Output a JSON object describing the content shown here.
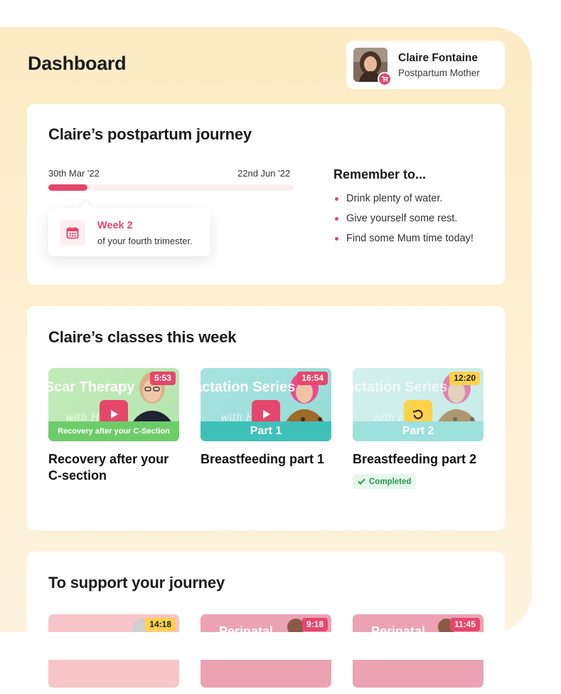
{
  "header": {
    "title": "Dashboard"
  },
  "profile": {
    "name": "Claire Fontaine",
    "role": "Postpartum Mother",
    "avatar_icon": "user-avatar",
    "badge_icon": "stroller-icon"
  },
  "journey": {
    "title": "Claire’s postpartum journey",
    "start_date": "30th Mar '22",
    "end_date": "22nd Jun '22",
    "progress": 0.16,
    "week_label": "Week 2",
    "week_sub": "of your fourth trimester.",
    "week_icon": "calendar-icon"
  },
  "remember": {
    "title": "Remember to...",
    "items": [
      "Drink plenty of water.",
      "Give yourself some rest.",
      "Find some Mum time today!"
    ]
  },
  "classes": {
    "title": "Claire’s classes this week",
    "videos": [
      {
        "title": "Recovery after your C-section",
        "duration": "5:53",
        "thumb_title": "Scar Therapy",
        "thumb_script": "with Ha",
        "band": "Recovery after your C-Section",
        "action_icon": "play-icon"
      },
      {
        "title": "Breastfeeding part 1",
        "duration": "16:54",
        "thumb_title": "Lactation Series",
        "thumb_script": "with H",
        "band": "Part 1",
        "action_icon": "play-icon"
      },
      {
        "title": "Breastfeeding part 2",
        "duration": "12:20",
        "thumb_title": "Lactation Series",
        "thumb_script": "with H",
        "band": "Part 2",
        "action_icon": "replay-icon",
        "status": "Completed"
      }
    ]
  },
  "support": {
    "title": "To support your journey",
    "videos": [
      {
        "duration": "14:18"
      },
      {
        "duration": "9:18",
        "thumb_title": "Perinatal"
      },
      {
        "duration": "11:45",
        "thumb_title": "Perinatal"
      }
    ]
  },
  "colors": {
    "accent": "#e6466b",
    "background": "#fcebc4",
    "completed": "#1f9a4d",
    "replay": "#ffd24a"
  }
}
